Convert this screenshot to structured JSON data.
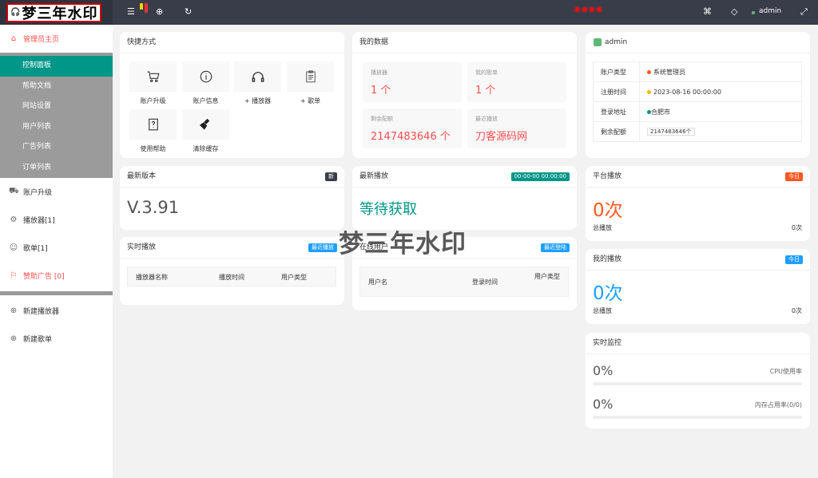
{
  "brand": {
    "logo_text": "梦三年水印"
  },
  "topbar": {
    "admin": "admin"
  },
  "sidebar": {
    "home": "管理员主页",
    "sub_items": [
      "控制面板",
      "帮助文档",
      "网站设置",
      "用户列表",
      "广告列表",
      "订单列表"
    ],
    "items": [
      "账户升级",
      "播放器[1]",
      "歌单[1]",
      "赞助广告 [0]"
    ],
    "items2": [
      "新建播放器",
      "新建歌单"
    ]
  },
  "shortcuts": {
    "title": "快捷方式",
    "items": [
      "账户升级",
      "账户信息",
      "+ 播放器",
      "+ 歌单",
      "使用帮助",
      "清除缓存"
    ]
  },
  "mydata": {
    "title": "我的数据",
    "players_label": "播放器",
    "players_val": "1 个",
    "playlists_label": "我的歌单",
    "playlists_val": "1 个",
    "quota_label": "剩余配额",
    "quota_val": "2147483646 个",
    "recent_label": "最近播放",
    "recent_val": "刀客源码网"
  },
  "account": {
    "name": "admin",
    "rows": [
      {
        "k": "账户类型",
        "v": "系统管理员",
        "dot": "#ff5722"
      },
      {
        "k": "注册时间",
        "v": "2023-08-16 00:00:00",
        "dot": "#ffb800"
      },
      {
        "k": "登录地址",
        "v": "合肥市",
        "dot": "#009688"
      },
      {
        "k": "剩余配额",
        "v": "2147483646个"
      }
    ]
  },
  "version": {
    "title": "最新版本",
    "badge": "新",
    "value": "V.3.91"
  },
  "latest": {
    "title": "最新播放",
    "badge": "00-00-00 00:00:00",
    "value": "等待获取"
  },
  "realtime": {
    "title": "实时播放",
    "badge": "最近播放",
    "cols": [
      "播放器名称",
      "播放时间",
      "用户类型"
    ]
  },
  "login": {
    "title": "在线用户",
    "badge": "最近登陆",
    "cols": [
      "用户名",
      "登录时间",
      "用户类型"
    ]
  },
  "platform": {
    "title": "平台播放",
    "badge": "今日",
    "value": "0次",
    "total_label": "总播放",
    "total_val": "0次"
  },
  "myplay": {
    "title": "我的播放",
    "badge": "今日",
    "value": "0次",
    "total_label": "总播放",
    "total_val": "0次"
  },
  "monitor": {
    "title": "实时监控",
    "cpu_val": "0%",
    "cpu_label": "CPU使用率",
    "mem_val": "0%",
    "mem_label": "内存占用率(0/0)"
  },
  "watermark": "梦三年水印",
  "colors": {
    "accent": "#009688",
    "danger": "#fd4e4e",
    "orange": "#ff5722",
    "blue": "#1e9fff"
  }
}
